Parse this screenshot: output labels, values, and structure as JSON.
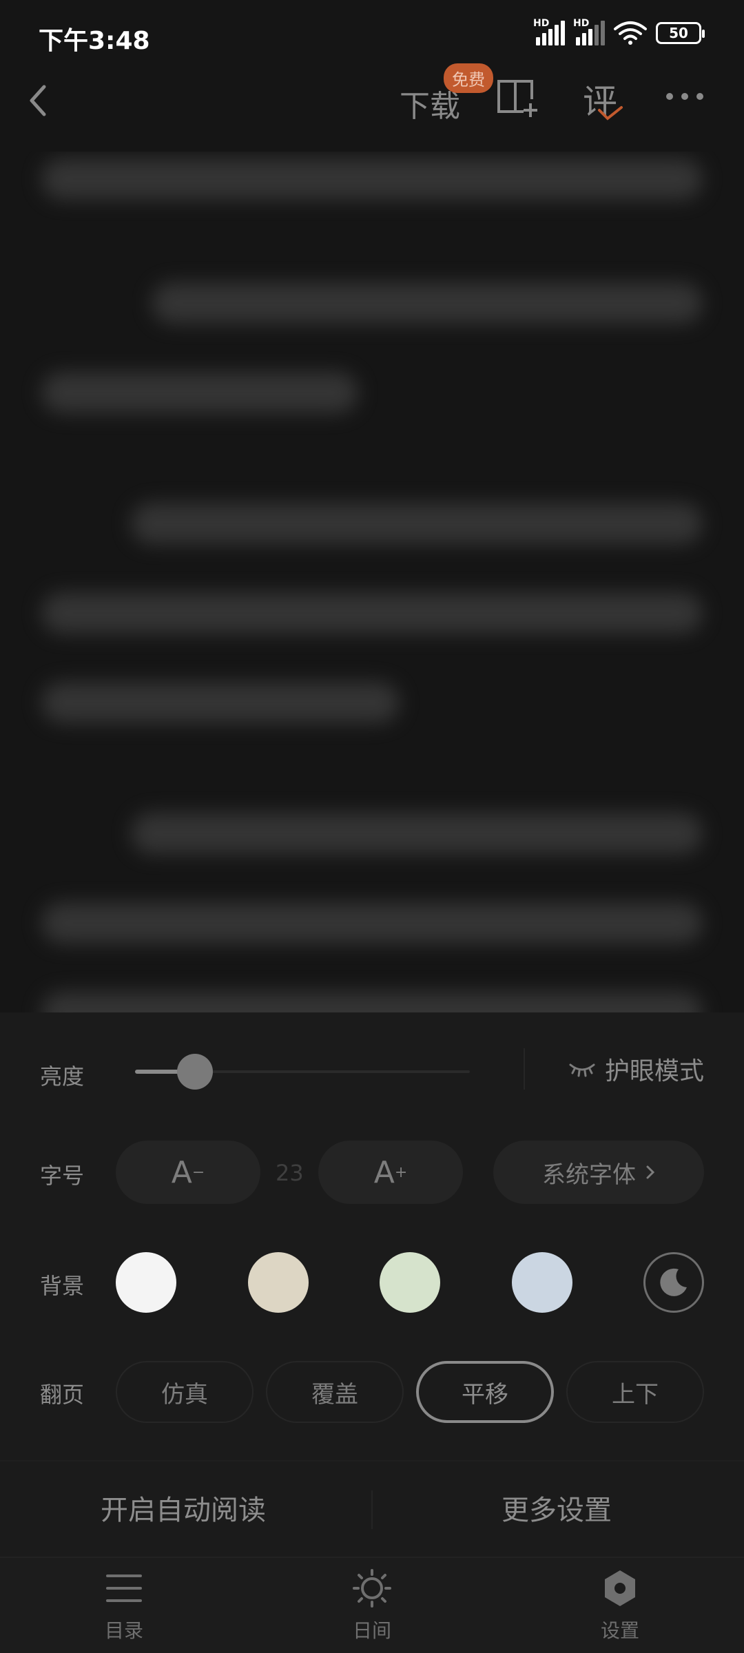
{
  "status_bar": {
    "time": "下午3:48",
    "signal1_label": "HD",
    "signal2_label": "HD",
    "battery": "50"
  },
  "toolbar": {
    "download_label": "下载",
    "free_badge": "免费",
    "review_label": "评"
  },
  "settings": {
    "brightness_label": "亮度",
    "brightness_value": 0.18,
    "eye_mode_label": "护眼模式",
    "font_size_label": "字号",
    "font_decrease": "A",
    "font_increase": "A",
    "font_size_value": "23",
    "system_font_label": "系统字体",
    "background_label": "背景",
    "background_colors": [
      "#f4f4f4",
      "#ddd6c4",
      "#d6e3cc",
      "#cbd6e2"
    ],
    "page_turn_label": "翻页",
    "page_turn_options": [
      "仿真",
      "覆盖",
      "平移",
      "上下"
    ],
    "page_turn_selected": "平移",
    "auto_read_label": "开启自动阅读",
    "more_settings_label": "更多设置"
  },
  "bottom_nav": {
    "items": [
      {
        "label": "目录",
        "icon": "list-icon"
      },
      {
        "label": "日间",
        "icon": "sun-icon"
      },
      {
        "label": "设置",
        "icon": "settings-icon"
      }
    ]
  },
  "colors": {
    "accent": "#c25a2e",
    "panel_bg": "#1b1b1b",
    "page_bg": "#151515"
  }
}
